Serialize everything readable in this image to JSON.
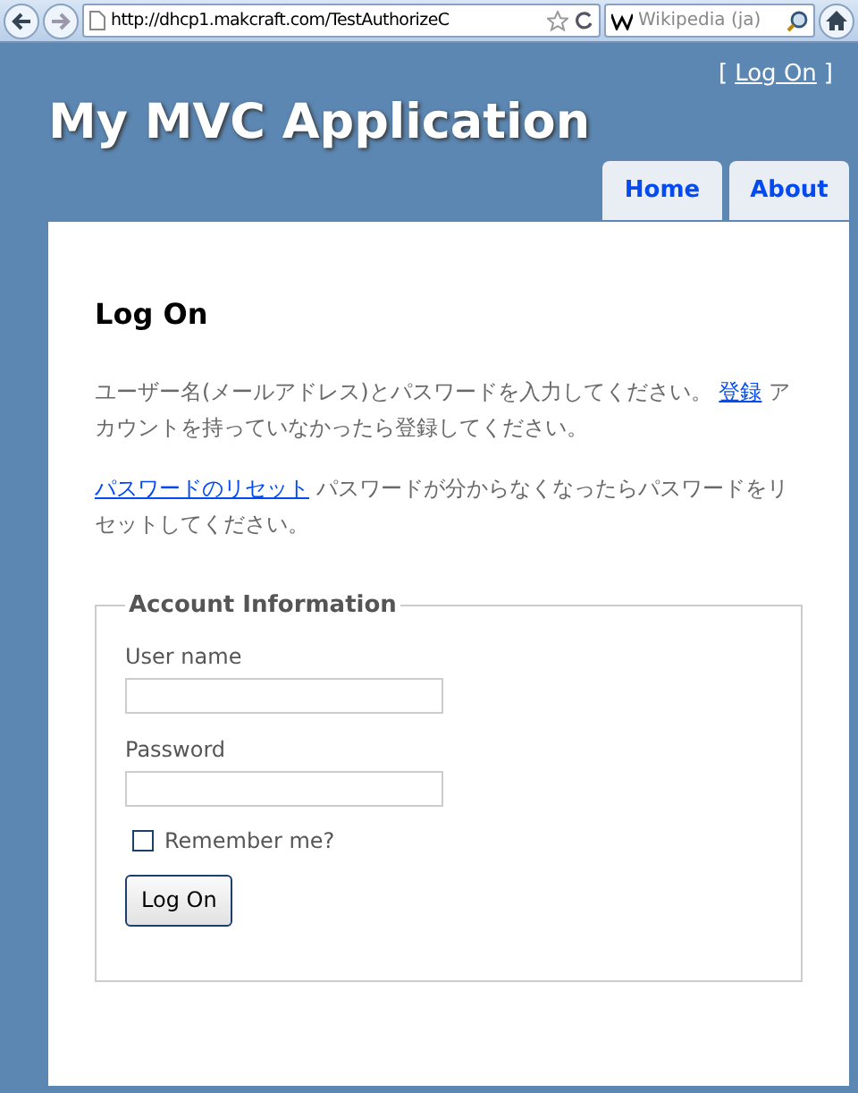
{
  "browser": {
    "address": "http://dhcp1.makcraft.com/TestAuthorizeC",
    "search_placeholder": "Wikipedia (ja)"
  },
  "header": {
    "title": "My MVC Application",
    "login_open": "[",
    "login_link": "Log On",
    "login_close": "]"
  },
  "menu": [
    {
      "label": "Home",
      "selected": false
    },
    {
      "label": "About",
      "selected": false
    }
  ],
  "main": {
    "heading": "Log On",
    "paragraphs": [
      {
        "before": "ユーザー名(メールアドレス)とパスワードを入力してください。 ",
        "link": "登録",
        "after": " アカウントを持っていなかったら登録してください。"
      },
      {
        "link": "パスワードのリセット",
        "after": " パスワードが分からなくなったらパスワードをリセットしてください。"
      }
    ],
    "fieldset": {
      "legend": "Account Information",
      "fields": [
        {
          "label": "User name"
        },
        {
          "label": "Password"
        }
      ],
      "remember": {
        "label": "Remember me?",
        "checked": false
      },
      "submit": "Log On"
    }
  }
}
